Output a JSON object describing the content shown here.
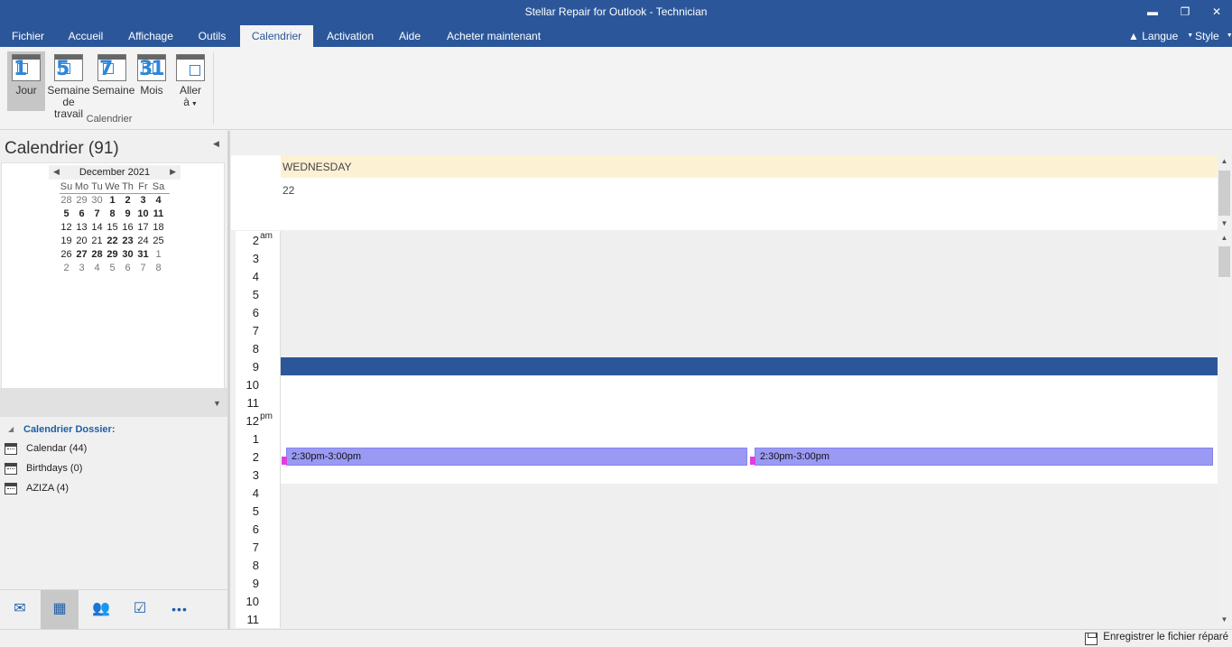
{
  "window": {
    "title": "Stellar Repair for Outlook - Technician",
    "minimize": "▬",
    "restore": "❐",
    "close": "✕"
  },
  "menu": {
    "items": [
      "Fichier",
      "Accueil",
      "Affichage",
      "Outils",
      "Calendrier",
      "Activation",
      "Aide",
      "Acheter maintenant"
    ],
    "active": "Calendrier",
    "language": "Langue",
    "style": "Style"
  },
  "ribbon": {
    "buttons": [
      {
        "label": "Jour",
        "icon_num": "1"
      },
      {
        "label": "Semaine de travail",
        "line1": "Semaine",
        "line2": "de travail",
        "icon_num": "5"
      },
      {
        "label": "Semaine",
        "icon_num": "7"
      },
      {
        "label": "Mois",
        "icon_num": "31"
      },
      {
        "label": "Aller à",
        "line1": "Aller",
        "line2": "à"
      }
    ],
    "group_label": "Calendrier"
  },
  "left_pane": {
    "title": "Calendrier (91)",
    "mini_calendar": {
      "month": "December 2021",
      "dow": [
        "Su",
        "Mo",
        "Tu",
        "We",
        "Th",
        "Fr",
        "Sa"
      ],
      "weeks": [
        [
          "28",
          "29",
          "30",
          "1",
          "2",
          "3",
          "4"
        ],
        [
          "5",
          "6",
          "7",
          "8",
          "9",
          "10",
          "11"
        ],
        [
          "12",
          "13",
          "14",
          "15",
          "16",
          "17",
          "18"
        ],
        [
          "19",
          "20",
          "21",
          "22",
          "23",
          "24",
          "25"
        ],
        [
          "26",
          "27",
          "28",
          "29",
          "30",
          "31",
          "1"
        ],
        [
          "2",
          "3",
          "4",
          "5",
          "6",
          "7",
          "8"
        ]
      ]
    },
    "folder_header": "Calendrier Dossier:",
    "folders": [
      "Calendar (44)",
      "Birthdays (0)",
      "AZIZA (4)"
    ],
    "nav": [
      {
        "name": "mail-icon",
        "glyph": "✉"
      },
      {
        "name": "calendar-icon",
        "glyph": "▦"
      },
      {
        "name": "contacts-icon",
        "glyph": "👥"
      },
      {
        "name": "tasks-icon",
        "glyph": "☑"
      },
      {
        "name": "more-icon",
        "glyph": "•••"
      }
    ]
  },
  "calendar": {
    "day_name": "WEDNESDAY",
    "day_number": "22",
    "hours": [
      {
        "n": "2",
        "ap": "am"
      },
      {
        "n": "3",
        "ap": ""
      },
      {
        "n": "4",
        "ap": ""
      },
      {
        "n": "5",
        "ap": ""
      },
      {
        "n": "6",
        "ap": ""
      },
      {
        "n": "7",
        "ap": ""
      },
      {
        "n": "8",
        "ap": ""
      },
      {
        "n": "9",
        "ap": ""
      },
      {
        "n": "10",
        "ap": ""
      },
      {
        "n": "11",
        "ap": ""
      },
      {
        "n": "12",
        "ap": "pm"
      },
      {
        "n": "1",
        "ap": ""
      },
      {
        "n": "2",
        "ap": ""
      },
      {
        "n": "3",
        "ap": ""
      },
      {
        "n": "4",
        "ap": ""
      },
      {
        "n": "5",
        "ap": ""
      },
      {
        "n": "6",
        "ap": ""
      },
      {
        "n": "7",
        "ap": ""
      },
      {
        "n": "8",
        "ap": ""
      },
      {
        "n": "9",
        "ap": ""
      },
      {
        "n": "10",
        "ap": ""
      },
      {
        "n": "11",
        "ap": ""
      }
    ],
    "appointments": [
      {
        "time": "2:30pm-3:00pm"
      },
      {
        "time": "2:30pm-3:00pm"
      }
    ]
  },
  "status": {
    "save_label": "Enregistrer le fichier réparé"
  },
  "colors": {
    "brand": "#2b579a",
    "appointment": "#9a9af5",
    "appointment_marker": "#e23ce2",
    "day_header": "#fdf1d3"
  }
}
